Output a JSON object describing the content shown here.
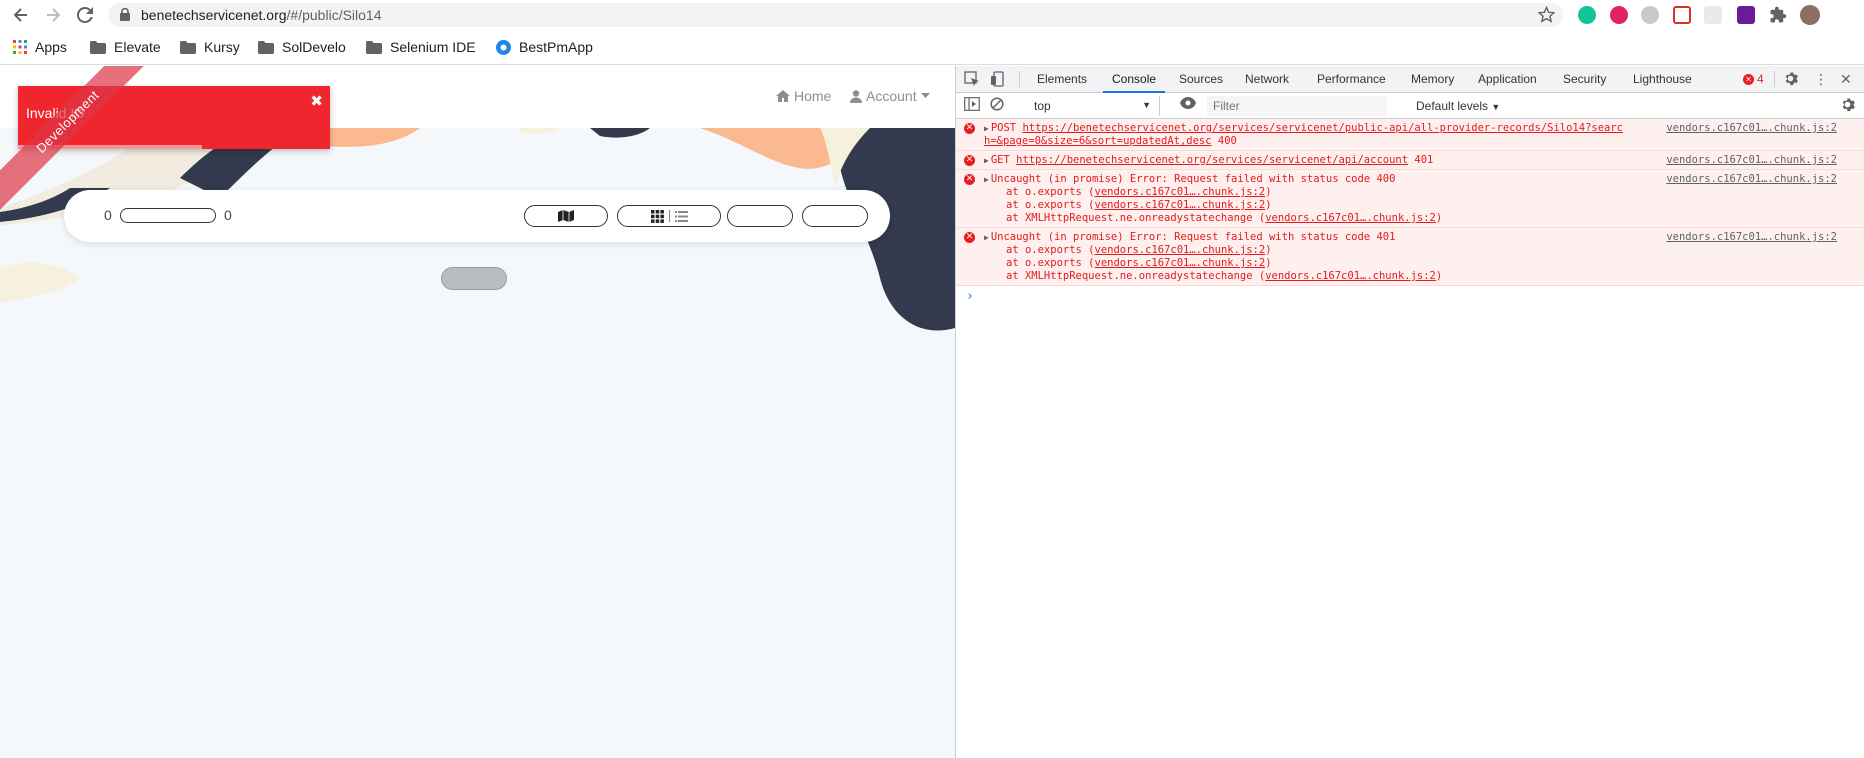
{
  "browser": {
    "url_host": "benetechservicenet.org",
    "url_path": "/#/public/Silo14"
  },
  "bookmarks": [
    {
      "label": "Apps",
      "icon": "apps-grid-icon"
    },
    {
      "label": "Elevate",
      "icon": "folder-icon"
    },
    {
      "label": "Kursy",
      "icon": "folder-icon"
    },
    {
      "label": "SolDevelo",
      "icon": "folder-icon"
    },
    {
      "label": "Selenium IDE",
      "icon": "folder-icon"
    },
    {
      "label": "BestPmApp",
      "icon": "bestpmapp-icon"
    }
  ],
  "page": {
    "nav_home": "Home",
    "nav_account": "Account",
    "toast_message": "Invalid ID",
    "ribbon_text": "Development",
    "count_left": "0",
    "count_right": "0"
  },
  "devtools": {
    "tabs": [
      "Elements",
      "Console",
      "Sources",
      "Network",
      "Performance",
      "Memory",
      "Application",
      "Security",
      "Lighthouse"
    ],
    "active_tab": "Console",
    "error_count": "4",
    "context": "top",
    "filter_placeholder": "Filter",
    "levels": "Default levels",
    "messages": [
      {
        "method": "POST",
        "url": "https://benetechservicenet.org/services/servicenet/public-api/all-provider-records/Silo14?searc",
        "url_cont": "h=&page=0&size=6&sort=updatedAt,desc",
        "status": "400",
        "source": "vendors.c167c01….chunk.js:2"
      },
      {
        "method": "GET",
        "url": "https://benetechservicenet.org/services/servicenet/api/account",
        "status": "401",
        "source": "vendors.c167c01….chunk.js:2"
      },
      {
        "text": "Uncaught (in promise) Error: Request failed with status code 400",
        "source": "vendors.c167c01….chunk.js:2",
        "stack": [
          {
            "prefix": "at o.exports (",
            "link": "vendors.c167c01….chunk.js:2",
            "suffix": ")"
          },
          {
            "prefix": "at o.exports (",
            "link": "vendors.c167c01….chunk.js:2",
            "suffix": ")"
          },
          {
            "prefix": "at XMLHttpRequest.ne.onreadystatechange (",
            "link": "vendors.c167c01….chunk.js:2",
            "suffix": ")"
          }
        ]
      },
      {
        "text": "Uncaught (in promise) Error: Request failed with status code 401",
        "source": "vendors.c167c01….chunk.js:2",
        "stack": [
          {
            "prefix": "at o.exports (",
            "link": "vendors.c167c01….chunk.js:2",
            "suffix": ")"
          },
          {
            "prefix": "at o.exports (",
            "link": "vendors.c167c01….chunk.js:2",
            "suffix": ")"
          },
          {
            "prefix": "at XMLHttpRequest.ne.onreadystatechange (",
            "link": "vendors.c167c01….chunk.js:2",
            "suffix": ")"
          }
        ]
      }
    ]
  },
  "colors": {
    "toast": "#f0262f",
    "console_error": "#e31b1b",
    "accent": "#1a73e8"
  }
}
